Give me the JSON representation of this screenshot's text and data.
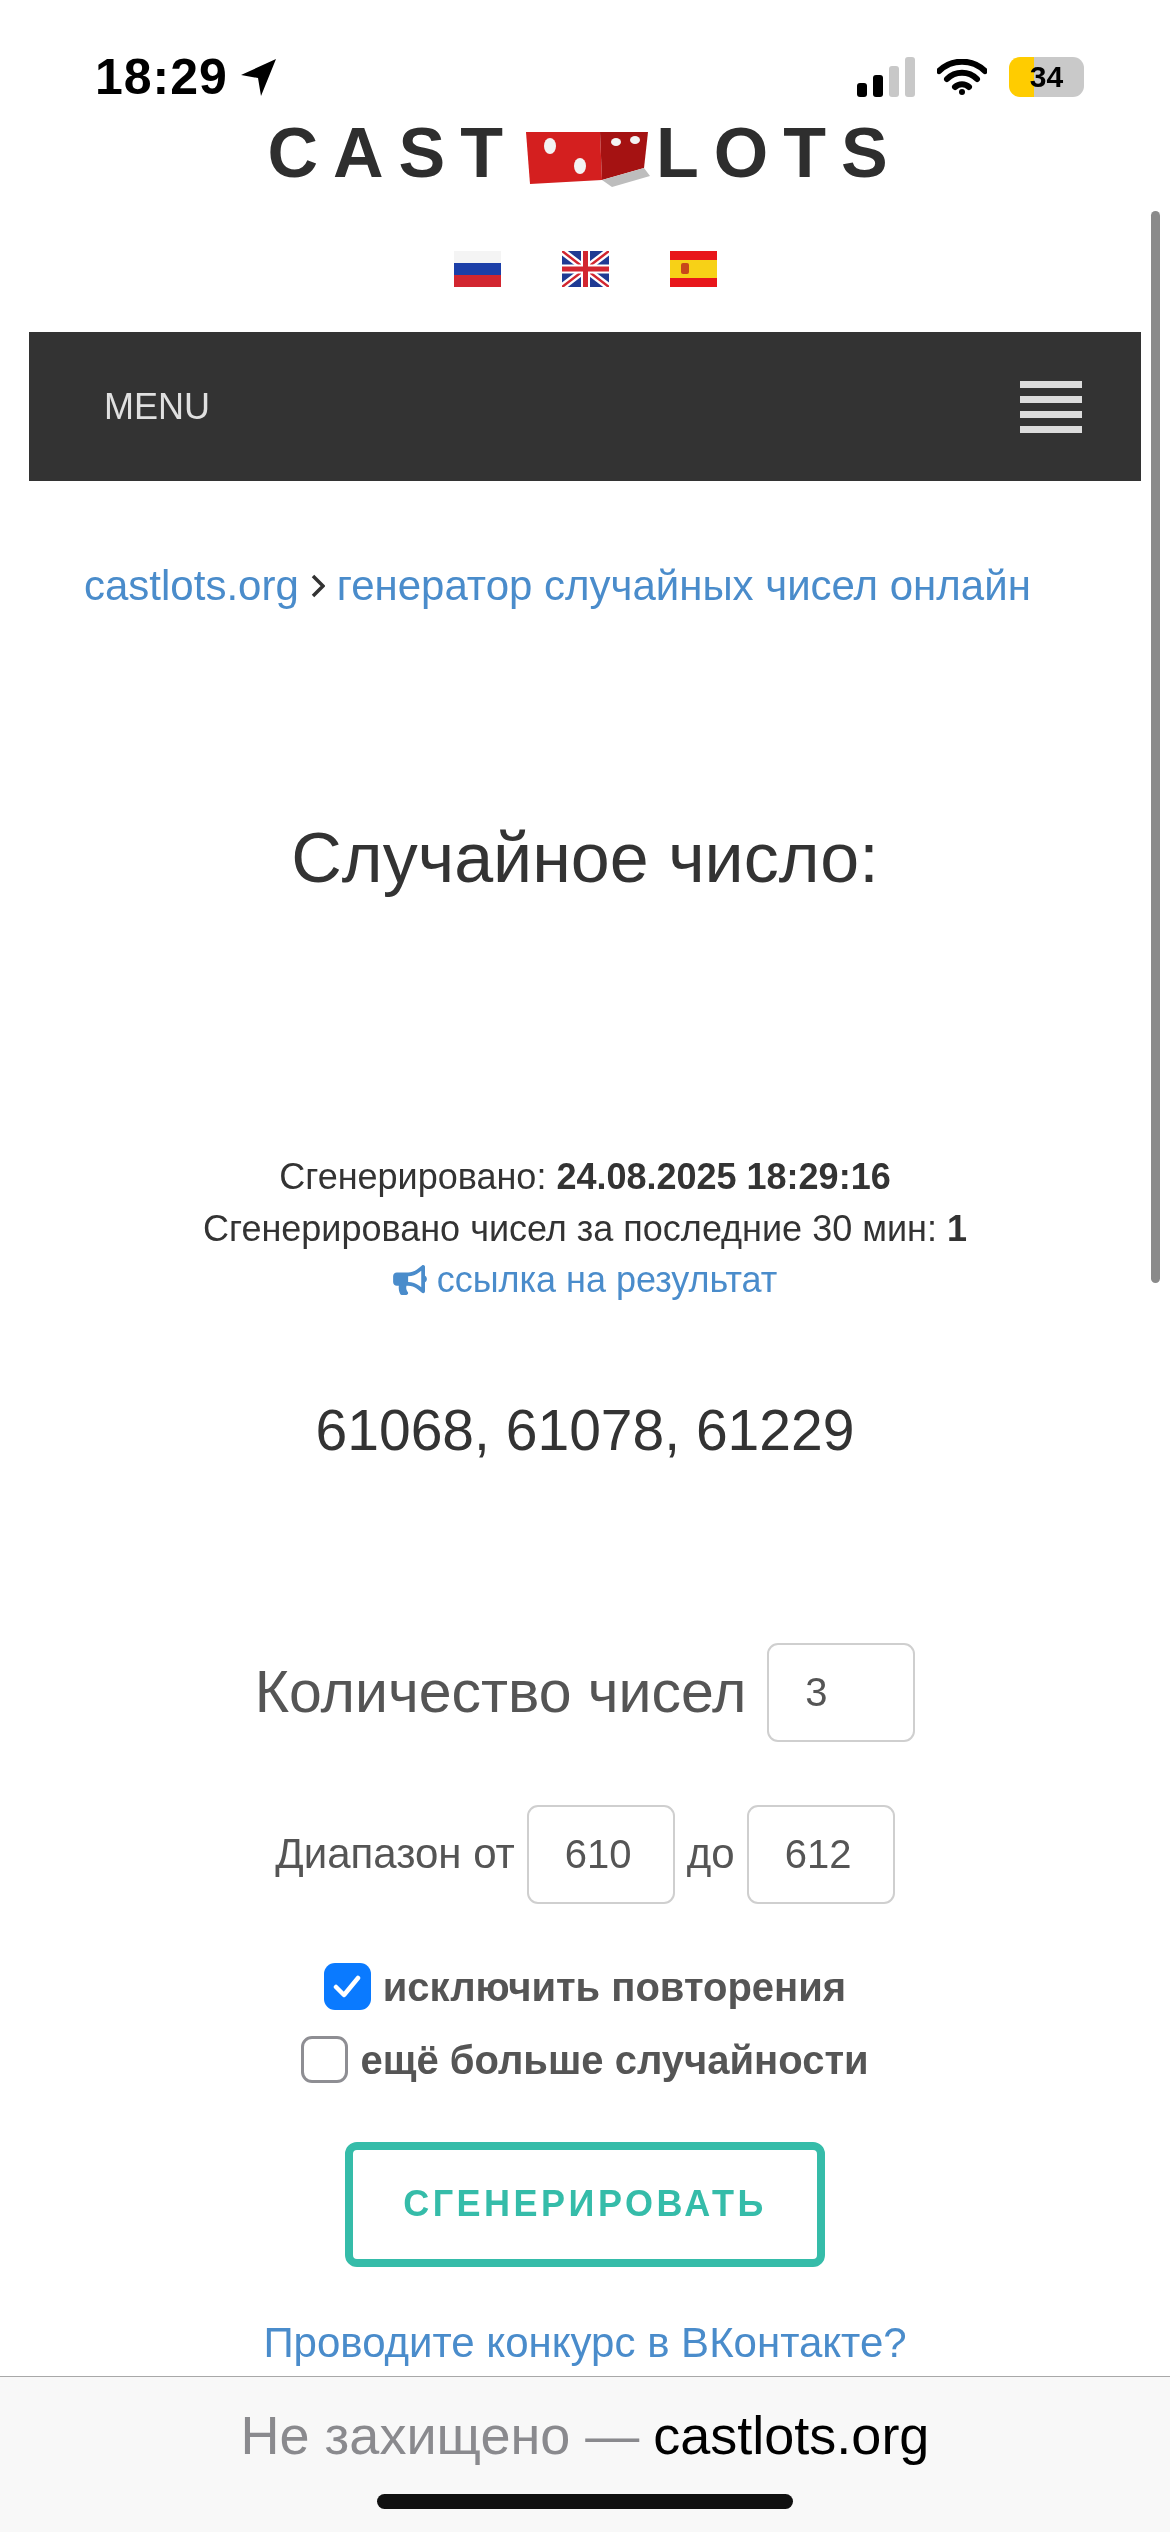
{
  "status_bar": {
    "time": "18:29",
    "battery": "34"
  },
  "logo": {
    "left": "CAST",
    "right": "LOTS"
  },
  "languages": [
    {
      "kind": "russia"
    },
    {
      "kind": "britain"
    },
    {
      "kind": "spain"
    }
  ],
  "nav": {
    "label": "MENU"
  },
  "breadcrumb": [
    {
      "label": "castlots.org"
    },
    {
      "label": "генератор случайных чисел онлайн"
    }
  ],
  "result": {
    "title": "Случайное число:",
    "generated": "Сгенерировано: **24.08.2025 18:29:16**",
    "count_note": "Сгенерировано чисел за последние 30 мин: **1**",
    "share_link": "ссылка на результат",
    "numbers": "61068, 61078, 61229"
  },
  "form": {
    "count_label": "Количество чисел",
    "count_value": "3",
    "range_from_label": "Диапазон от",
    "range_from_value": "610",
    "range_to_label": "до",
    "range_to_value": "612",
    "options": [
      {
        "label": "исключить повторения",
        "checked": true
      },
      {
        "label": "ещё больше случайности",
        "checked": false
      }
    ],
    "submit": "СГЕНЕРИРОВАТЬ"
  },
  "vk_link": "Проводите конкурс в ВКонтакте?",
  "browser_bar": {
    "security": "Не захищено —",
    "domain": "castlots.org"
  }
}
